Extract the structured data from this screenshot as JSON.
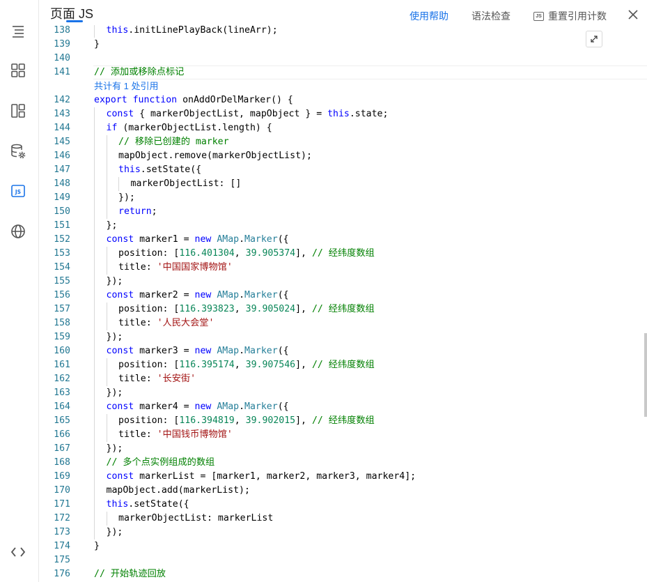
{
  "header": {
    "title": "页面 JS",
    "help": "使用帮助",
    "syntax_check": "语法检查",
    "js_badge": "JS",
    "reset_ref_count": "重置引用计数"
  },
  "rail": {
    "items": [
      {
        "icon": "outline-icon"
      },
      {
        "icon": "components-icon"
      },
      {
        "icon": "layout-icon"
      },
      {
        "icon": "datasource-settings-icon"
      },
      {
        "icon": "js-icon",
        "label": "JS",
        "active": true
      },
      {
        "icon": "globe-icon"
      },
      {
        "icon": "code-icon"
      }
    ]
  },
  "editor": {
    "codelens": "共计有 1 处引用",
    "lines": [
      {
        "n": "138",
        "indent": 1,
        "t": [
          [
            "kw",
            "this"
          ],
          [
            "",
            "."
          ],
          [
            "",
            "initLinePlayBack(lineArr);"
          ]
        ]
      },
      {
        "n": "139",
        "indent": 0,
        "t": [
          [
            "",
            "}"
          ]
        ]
      },
      {
        "n": "140",
        "indent": 0,
        "t": []
      },
      {
        "n": "141",
        "indent": 0,
        "t": [
          [
            "cmt",
            "// 添加或移除点标记"
          ]
        ]
      },
      {
        "n": "142",
        "indent": 0,
        "t": [
          [
            "kw",
            "export"
          ],
          [
            "",
            " "
          ],
          [
            "kw",
            "function"
          ],
          [
            "",
            " onAddOrDelMarker() {"
          ]
        ]
      },
      {
        "n": "143",
        "indent": 1,
        "t": [
          [
            "kw",
            "const"
          ],
          [
            "",
            " { markerObjectList, mapObject } = "
          ],
          [
            "kw",
            "this"
          ],
          [
            "",
            ".state;"
          ]
        ]
      },
      {
        "n": "144",
        "indent": 1,
        "t": [
          [
            "kw",
            "if"
          ],
          [
            "",
            " (markerObjectList.length) {"
          ]
        ]
      },
      {
        "n": "145",
        "indent": 2,
        "t": [
          [
            "cmt",
            "// 移除已创建的 marker"
          ]
        ]
      },
      {
        "n": "146",
        "indent": 2,
        "t": [
          [
            "",
            "mapObject.remove(markerObjectList);"
          ]
        ]
      },
      {
        "n": "147",
        "indent": 2,
        "t": [
          [
            "kw",
            "this"
          ],
          [
            "",
            ".setState({"
          ]
        ]
      },
      {
        "n": "148",
        "indent": 3,
        "t": [
          [
            "",
            "markerObjectList: []"
          ]
        ]
      },
      {
        "n": "149",
        "indent": 2,
        "t": [
          [
            "",
            "});"
          ]
        ]
      },
      {
        "n": "150",
        "indent": 2,
        "t": [
          [
            "kw",
            "return"
          ],
          [
            "",
            ";"
          ]
        ]
      },
      {
        "n": "151",
        "indent": 1,
        "t": [
          [
            "",
            "};"
          ]
        ]
      },
      {
        "n": "152",
        "indent": 1,
        "t": [
          [
            "kw",
            "const"
          ],
          [
            "",
            " marker1 = "
          ],
          [
            "kw",
            "new"
          ],
          [
            "",
            " "
          ],
          [
            "cls",
            "AMap"
          ],
          [
            "",
            "."
          ],
          [
            "cls",
            "Marker"
          ],
          [
            "",
            "({"
          ]
        ]
      },
      {
        "n": "153",
        "indent": 2,
        "t": [
          [
            "",
            "position: ["
          ],
          [
            "num",
            "116.401304"
          ],
          [
            "",
            ", "
          ],
          [
            "num",
            "39.905374"
          ],
          [
            "",
            "], "
          ],
          [
            "cmt",
            "// 经纬度数组"
          ]
        ]
      },
      {
        "n": "154",
        "indent": 2,
        "t": [
          [
            "",
            "title: "
          ],
          [
            "str",
            "'中国国家博物馆'"
          ]
        ]
      },
      {
        "n": "155",
        "indent": 1,
        "t": [
          [
            "",
            "});"
          ]
        ]
      },
      {
        "n": "156",
        "indent": 1,
        "t": [
          [
            "kw",
            "const"
          ],
          [
            "",
            " marker2 = "
          ],
          [
            "kw",
            "new"
          ],
          [
            "",
            " "
          ],
          [
            "cls",
            "AMap"
          ],
          [
            "",
            "."
          ],
          [
            "cls",
            "Marker"
          ],
          [
            "",
            "({"
          ]
        ]
      },
      {
        "n": "157",
        "indent": 2,
        "t": [
          [
            "",
            "position: ["
          ],
          [
            "num",
            "116.393823"
          ],
          [
            "",
            ", "
          ],
          [
            "num",
            "39.905024"
          ],
          [
            "",
            "], "
          ],
          [
            "cmt",
            "// 经纬度数组"
          ]
        ]
      },
      {
        "n": "158",
        "indent": 2,
        "t": [
          [
            "",
            "title: "
          ],
          [
            "str",
            "'人民大会堂'"
          ]
        ]
      },
      {
        "n": "159",
        "indent": 1,
        "t": [
          [
            "",
            "});"
          ]
        ]
      },
      {
        "n": "160",
        "indent": 1,
        "t": [
          [
            "kw",
            "const"
          ],
          [
            "",
            " marker3 = "
          ],
          [
            "kw",
            "new"
          ],
          [
            "",
            " "
          ],
          [
            "cls",
            "AMap"
          ],
          [
            "",
            "."
          ],
          [
            "cls",
            "Marker"
          ],
          [
            "",
            "({"
          ]
        ]
      },
      {
        "n": "161",
        "indent": 2,
        "t": [
          [
            "",
            "position: ["
          ],
          [
            "num",
            "116.395174"
          ],
          [
            "",
            ", "
          ],
          [
            "num",
            "39.907546"
          ],
          [
            "",
            "], "
          ],
          [
            "cmt",
            "// 经纬度数组"
          ]
        ]
      },
      {
        "n": "162",
        "indent": 2,
        "t": [
          [
            "",
            "title: "
          ],
          [
            "str",
            "'长安街'"
          ]
        ]
      },
      {
        "n": "163",
        "indent": 1,
        "t": [
          [
            "",
            "});"
          ]
        ]
      },
      {
        "n": "164",
        "indent": 1,
        "t": [
          [
            "kw",
            "const"
          ],
          [
            "",
            " marker4 = "
          ],
          [
            "kw",
            "new"
          ],
          [
            "",
            " "
          ],
          [
            "cls",
            "AMap"
          ],
          [
            "",
            "."
          ],
          [
            "cls",
            "Marker"
          ],
          [
            "",
            "({"
          ]
        ]
      },
      {
        "n": "165",
        "indent": 2,
        "t": [
          [
            "",
            "position: ["
          ],
          [
            "num",
            "116.394819"
          ],
          [
            "",
            ", "
          ],
          [
            "num",
            "39.902015"
          ],
          [
            "",
            "], "
          ],
          [
            "cmt",
            "// 经纬度数组"
          ]
        ]
      },
      {
        "n": "166",
        "indent": 2,
        "t": [
          [
            "",
            "title: "
          ],
          [
            "str",
            "'中国钱币博物馆'"
          ]
        ]
      },
      {
        "n": "167",
        "indent": 1,
        "t": [
          [
            "",
            "});"
          ]
        ]
      },
      {
        "n": "168",
        "indent": 1,
        "t": [
          [
            "cmt",
            "// 多个点实例组成的数组"
          ]
        ]
      },
      {
        "n": "169",
        "indent": 1,
        "t": [
          [
            "kw",
            "const"
          ],
          [
            "",
            " markerList = [marker1, marker2, marker3, marker4];"
          ]
        ]
      },
      {
        "n": "170",
        "indent": 1,
        "t": [
          [
            "",
            "mapObject.add(markerList);"
          ]
        ]
      },
      {
        "n": "171",
        "indent": 1,
        "t": [
          [
            "kw",
            "this"
          ],
          [
            "",
            ".setState({"
          ]
        ]
      },
      {
        "n": "172",
        "indent": 2,
        "t": [
          [
            "",
            "markerObjectList: markerList"
          ]
        ]
      },
      {
        "n": "173",
        "indent": 1,
        "t": [
          [
            "",
            "});"
          ]
        ]
      },
      {
        "n": "174",
        "indent": 0,
        "t": [
          [
            "",
            "}"
          ]
        ]
      },
      {
        "n": "175",
        "indent": 0,
        "t": []
      },
      {
        "n": "176",
        "indent": 0,
        "t": [
          [
            "cmt",
            "// 开始轨迹回放"
          ]
        ]
      }
    ]
  }
}
